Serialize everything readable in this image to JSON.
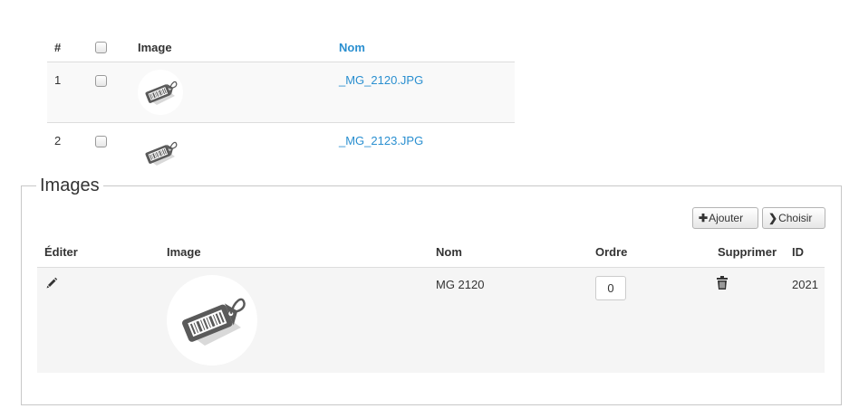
{
  "file_table": {
    "headers": {
      "num": "#",
      "image": "Image",
      "nom": "Nom"
    },
    "rows": [
      {
        "num": "1",
        "name": "_MG_2120.JPG",
        "thumb_icon": "price-tag-icon"
      },
      {
        "num": "2",
        "name": "_MG_2123.JPG",
        "thumb_icon": "price-tag-icon"
      }
    ]
  },
  "images_panel": {
    "legend": "Images",
    "buttons": {
      "add_label": "Ajouter",
      "add_icon": "plus-icon",
      "choose_label": "Choisir",
      "choose_icon": "chevron-right-icon"
    },
    "headers": {
      "edit": "Éditer",
      "image": "Image",
      "nom": "Nom",
      "ordre": "Ordre",
      "supprimer": "Supprimer",
      "id": "ID"
    },
    "rows": [
      {
        "edit_icon": "pencil-icon",
        "image_icon": "price-tag-icon",
        "nom": "MG 2120",
        "ordre": "0",
        "delete_icon": "trash-icon",
        "id": "2021"
      }
    ]
  },
  "colors": {
    "link": "#2a8fd0",
    "tag_gray": "#5a5a5a",
    "row_stripe": "#f9f9f9",
    "border": "#dddddd"
  }
}
